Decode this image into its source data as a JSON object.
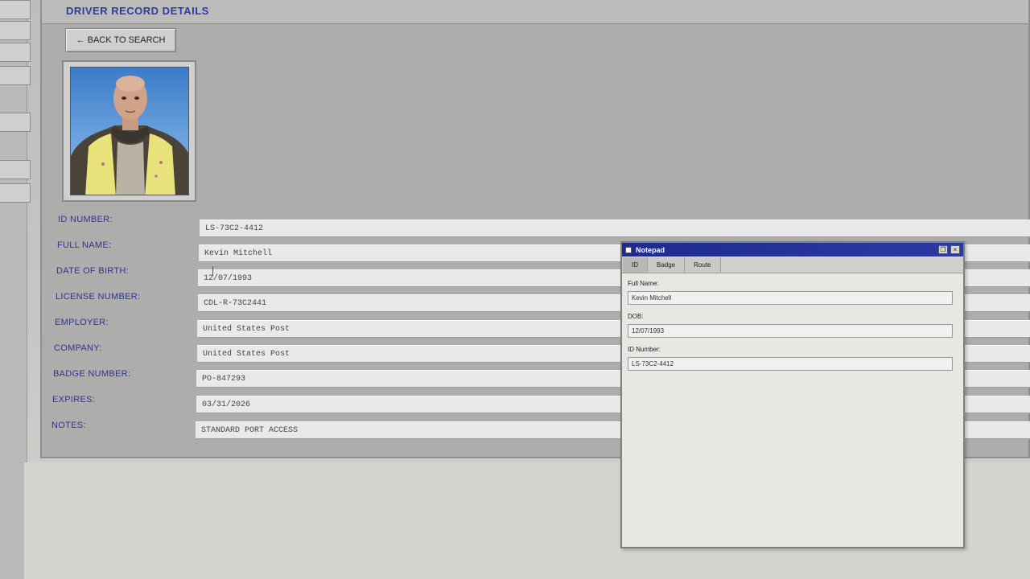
{
  "page": {
    "title": "DRIVER RECORD DETAILS",
    "back_button": "← BACK TO SEARCH"
  },
  "record": {
    "fields": [
      {
        "label": "ID NUMBER:",
        "value": "LS-73C2-4412"
      },
      {
        "label": "FULL NAME:",
        "value": "Kevin Mitchell"
      },
      {
        "label": "DATE OF BIRTH:",
        "value": "12/07/1993"
      },
      {
        "label": "LICENSE NUMBER:",
        "value": "CDL-R-73C2441"
      },
      {
        "label": "EMPLOYER:",
        "value": "United States Post"
      },
      {
        "label": "COMPANY:",
        "value": "United States Post"
      },
      {
        "label": "BADGE NUMBER:",
        "value": "PO-847293"
      },
      {
        "label": "EXPIRES:",
        "value": "03/31/2026"
      },
      {
        "label": "NOTES:",
        "value": "STANDARD PORT ACCESS"
      }
    ]
  },
  "notepad": {
    "title": "Notepad",
    "restore_glyph": "❐",
    "close_glyph": "×",
    "tabs": [
      "ID",
      "Badge",
      "Route"
    ],
    "active_tab": "ID",
    "fields": [
      {
        "label": "Full Name:",
        "value": "Kevin Mitchell"
      },
      {
        "label": "DOB:",
        "value": "12/07/1993"
      },
      {
        "label": "ID Number:",
        "value": "LS-73C2-4412"
      }
    ]
  },
  "colors": {
    "title_blue": "#2f3aa6",
    "label_blue": "#2a3596",
    "titlebar_blue": "#1e2a8c",
    "panel_gray": "#adadab"
  }
}
